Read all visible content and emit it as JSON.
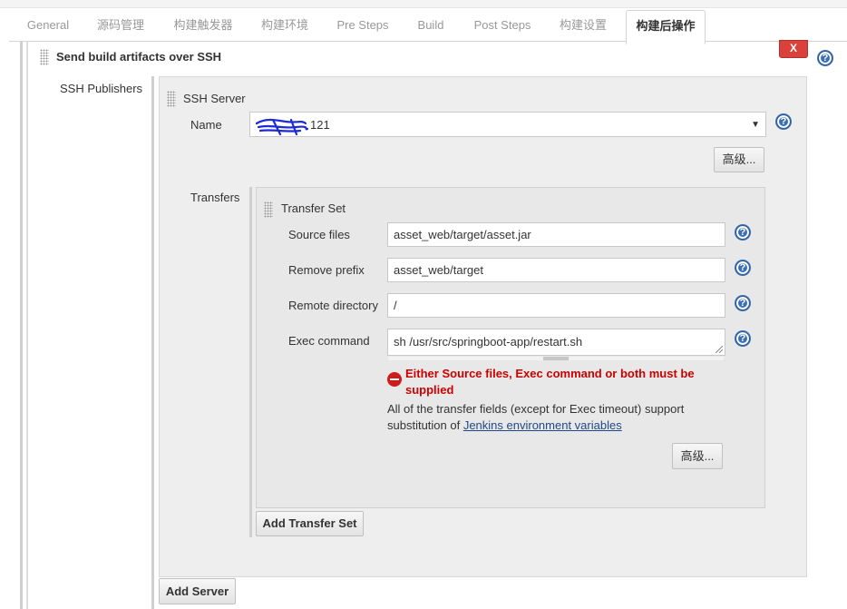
{
  "tabs": [
    {
      "label": "General"
    },
    {
      "label": "源码管理"
    },
    {
      "label": "构建触发器"
    },
    {
      "label": "构建环境"
    },
    {
      "label": "Pre Steps"
    },
    {
      "label": "Build"
    },
    {
      "label": "Post Steps"
    },
    {
      "label": "构建设置"
    },
    {
      "label": "构建后操作"
    }
  ],
  "active_tab": "构建后操作",
  "section": {
    "title": "Send build artifacts over SSH",
    "delete_label": "X",
    "help_glyph": "?"
  },
  "publishers": {
    "label": "SSH Publishers",
    "server": {
      "title": "SSH Server",
      "name_label": "Name",
      "name_value": "121",
      "advanced_label": "高级..."
    },
    "transfers_label": "Transfers",
    "transfer_set": {
      "title": "Transfer Set",
      "source_files_label": "Source files",
      "source_files_value": "asset_web/target/asset.jar",
      "remove_prefix_label": "Remove prefix",
      "remove_prefix_value": "asset_web/target",
      "remote_directory_label": "Remote directory",
      "remote_directory_value": "/",
      "exec_command_label": "Exec command",
      "exec_command_value": "sh /usr/src/springboot-app/restart.sh",
      "error_text": "Either Source files, Exec command or both must be supplied",
      "note_text": "All of the transfer fields (except for Exec timeout) support substitution of ",
      "note_link": "Jenkins environment variables",
      "advanced_label": "高级..."
    },
    "add_transfer_set_label": "Add Transfer Set",
    "add_server_label": "Add Server"
  },
  "colors": {
    "error": "#cc0000",
    "delete_button": "#d9413a",
    "help_icon": "#3c70b5",
    "link": "#204a87"
  }
}
